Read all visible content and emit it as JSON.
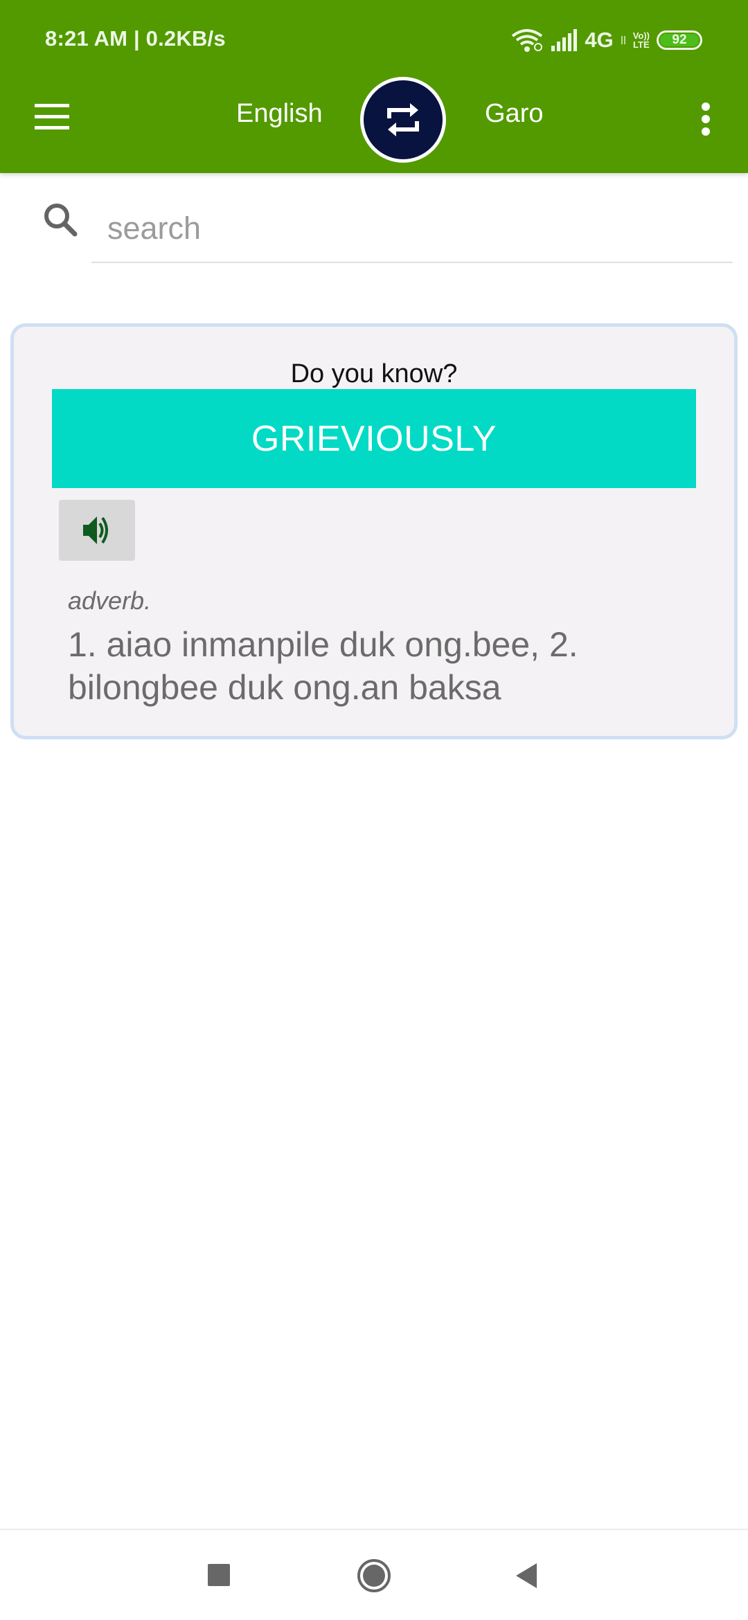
{
  "status_bar": {
    "time": "8:21 AM",
    "separator": "|",
    "net_speed": "0.2KB/s",
    "network_type": "4G",
    "volte_top": "Vo))",
    "volte_bottom": "LTE",
    "battery_level": "92",
    "icons": [
      "wifi-icon",
      "signal-icon",
      "network-activity-icon",
      "volte-icon",
      "battery-icon"
    ]
  },
  "app_bar": {
    "menu_icon": "hamburger-menu-icon",
    "source_language": "English",
    "swap_icon": "swap-arrows-icon",
    "target_language": "Garo",
    "overflow_icon": "more-vertical-icon"
  },
  "search": {
    "icon": "search-icon",
    "value": "",
    "placeholder": "search"
  },
  "word_of_day": {
    "title": "Do you know?",
    "word": "GRIEVIOUSLY",
    "speak_icon": "speaker-icon",
    "part_of_speech": "adverb.",
    "definition": "1. aiao inmanpile duk ong.bee, 2. bilongbee duk ong.an baksa"
  },
  "nav_bar": {
    "buttons": [
      "recent-apps",
      "home",
      "back"
    ]
  },
  "colors": {
    "app_bar": "#529a00",
    "swap_button": "#08133f",
    "word_box": "#03dac5",
    "card_background": "#f4f2f4",
    "card_border": "#cfdff3",
    "speaker_icon": "#0f5a1f",
    "battery_fill": "#4cbd1a"
  }
}
